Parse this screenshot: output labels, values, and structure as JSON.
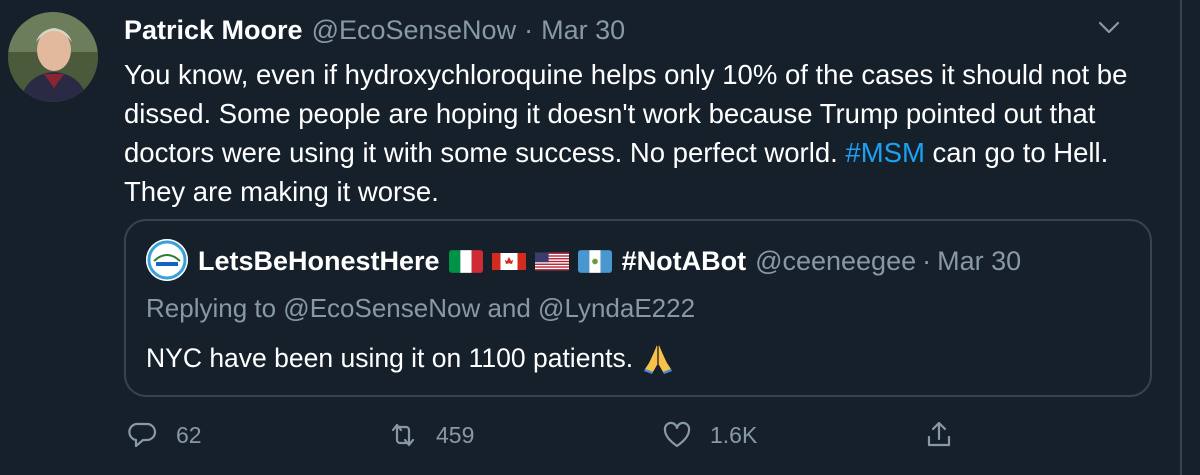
{
  "tweet": {
    "author_name": "Patrick Moore",
    "author_handle": "@EcoSenseNow",
    "separator": "·",
    "date": "Mar 30",
    "text_part1": "You know, even if hydroxychloroquine helps only 10% of the cases it should not be dissed. Some people are hoping it doesn't work because Trump pointed out that doctors were using it with some success. No perfect world. ",
    "hashtag": "#MSM",
    "text_part2": " can go to Hell. They are making it worse."
  },
  "quoted_tweet": {
    "author_name": "LetsBeHonestHere",
    "flags": [
      "italy-flag",
      "canada-flag",
      "usa-flag",
      "guatemala-flag"
    ],
    "name_suffix": "#NotABot",
    "author_handle": "@ceeneegee",
    "separator": "·",
    "date": "Mar 30",
    "replying_to": "Replying to @EcoSenseNow and @LyndaE222",
    "text": "NYC have been using it on 1100 patients.",
    "emoji": "folded-hands"
  },
  "actions": {
    "reply_count": "62",
    "retweet_count": "459",
    "like_count": "1.6K"
  },
  "colors": {
    "background": "#15202b",
    "text": "#ffffff",
    "secondary": "#8899a6",
    "accent": "#1da1f2",
    "border": "#38444d"
  },
  "icons": [
    "caret-down-icon",
    "reply-icon",
    "retweet-icon",
    "like-icon",
    "share-icon"
  ]
}
